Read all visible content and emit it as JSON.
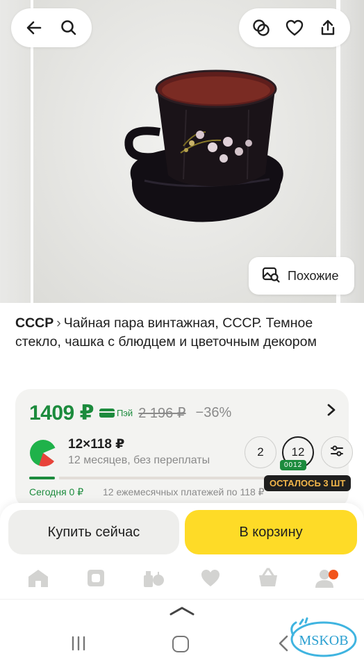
{
  "header": {
    "back_icon": "arrow-left-icon",
    "search_icon": "search-icon",
    "compare_icon": "compare-icon",
    "favorite_icon": "heart-icon",
    "share_icon": "share-icon"
  },
  "gallery": {
    "similar_label": "Похожие",
    "similar_icon": "image-search-icon"
  },
  "product": {
    "brand": "СССР",
    "separator": "›",
    "name": "Чайная пара винтажная, СССР. Темное стекло, чашка с блюдцем и цветочным декором"
  },
  "price": {
    "current": "1409 ₽",
    "pay_label": "Пэй",
    "old": "2 196 ₽",
    "discount": "−36%"
  },
  "installment": {
    "amount": "12×118 ₽",
    "subtitle": "12 месяцев, без переплаты",
    "options": [
      "2",
      "12"
    ],
    "selected_code": "0012",
    "today_label": "Сегодня 0 ₽",
    "monthly_label": "12 ежемесячных платежей по 118 ₽",
    "paid_fraction": 0.0833
  },
  "stock": {
    "label": "ОСТАЛОСЬ 3 ШТ"
  },
  "actions": {
    "buy_now": "Купить сейчас",
    "add_to_cart": "В корзину"
  },
  "tabs": [
    {
      "icon": "home-icon"
    },
    {
      "icon": "catalog-icon"
    },
    {
      "icon": "products-icon"
    },
    {
      "icon": "favorites-icon"
    },
    {
      "icon": "cart-icon"
    },
    {
      "icon": "profile-icon"
    }
  ],
  "watermark": "MSKOB",
  "colors": {
    "price_green": "#1c8b3d",
    "cart_yellow": "#fedb27",
    "stock_badge_bg": "#1f1f1f",
    "stock_badge_text": "#f2b64a",
    "notification": "#f2541b"
  }
}
